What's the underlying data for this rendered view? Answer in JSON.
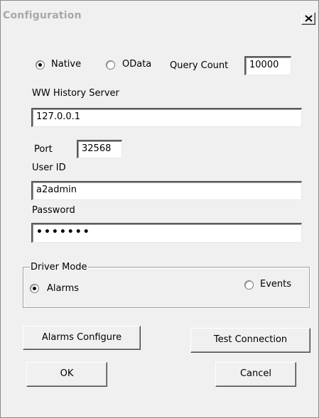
{
  "window": {
    "title": "Configuration"
  },
  "query": {
    "native_label": "Native",
    "odata_label": "OData",
    "selected": "native",
    "count_label": "Query Count",
    "count_value": "10000"
  },
  "server": {
    "label": "WW History Server",
    "value": "127.0.0.1"
  },
  "port": {
    "label": "Port",
    "value": "32568"
  },
  "user": {
    "label": "User ID",
    "value": "a2admin"
  },
  "password": {
    "label": "Password",
    "value": "•••••••"
  },
  "driver_mode": {
    "legend": "Driver Mode",
    "alarms_label": "Alarms",
    "events_label": "Events",
    "selected": "alarms"
  },
  "buttons": {
    "alarms_configure": "Alarms Configure",
    "test_connection": "Test Connection",
    "ok": "OK",
    "cancel": "Cancel"
  }
}
